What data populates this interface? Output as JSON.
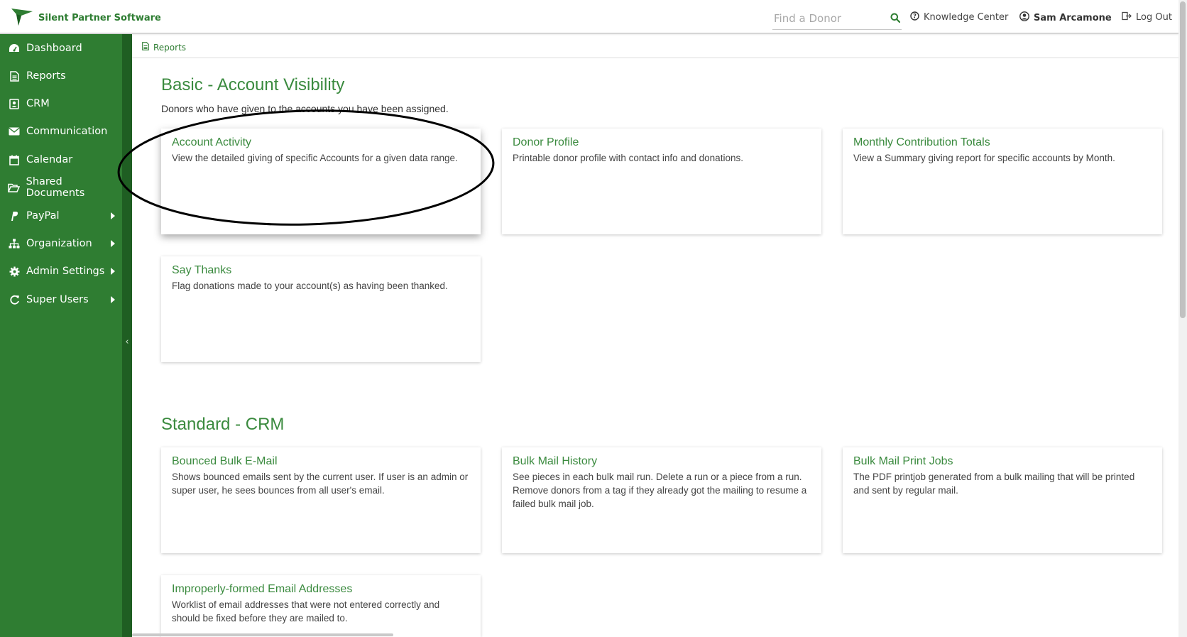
{
  "header": {
    "brand": "Silent Partner Software",
    "search_placeholder": "Find a Donor",
    "knowledge_center": "Knowledge Center",
    "user_name": "Sam Arcamone",
    "logout": "Log Out"
  },
  "sidebar": {
    "items": [
      {
        "label": "Dashboard",
        "icon": "dashboard-icon",
        "has_submenu": false
      },
      {
        "label": "Reports",
        "icon": "document-icon",
        "has_submenu": false
      },
      {
        "label": "CRM",
        "icon": "contact-card-icon",
        "has_submenu": false
      },
      {
        "label": "Communication",
        "icon": "envelope-icon",
        "has_submenu": false
      },
      {
        "label": "Calendar",
        "icon": "calendar-icon",
        "has_submenu": false
      },
      {
        "label": "Shared Documents",
        "icon": "folder-open-icon",
        "has_submenu": false
      },
      {
        "label": "PayPal",
        "icon": "paypal-icon",
        "has_submenu": true
      },
      {
        "label": "Organization",
        "icon": "sitemap-icon",
        "has_submenu": true
      },
      {
        "label": "Admin Settings",
        "icon": "gear-icon",
        "has_submenu": true
      },
      {
        "label": "Super Users",
        "icon": "refresh-icon",
        "has_submenu": true
      }
    ],
    "collapse_glyph": "‹"
  },
  "breadcrumb": {
    "label": "Reports"
  },
  "sections": [
    {
      "title": "Basic - Account Visibility",
      "subtitle": "Donors who have given to the accounts you have been assigned.",
      "cards": [
        {
          "title": "Account Activity",
          "description": "View the detailed giving of specific Accounts for a given data range."
        },
        {
          "title": "Donor Profile",
          "description": "Printable donor profile with contact info and donations."
        },
        {
          "title": "Monthly Contribution Totals",
          "description": "View a Summary giving report for specific accounts by Month."
        },
        {
          "title": "Say Thanks",
          "description": "Flag donations made to your account(s) as having been thanked."
        }
      ]
    },
    {
      "title": "Standard - CRM",
      "subtitle": "",
      "cards": [
        {
          "title": "Bounced Bulk E-Mail",
          "description": "Shows bounced emails sent by the current user. If user is an admin or super user, he sees bounces from all user's email."
        },
        {
          "title": "Bulk Mail History",
          "description": "See pieces in each bulk mail run. Delete a run or a piece from a run. Remove donors from a tag if they already got the mailing to resume a failed bulk mail job."
        },
        {
          "title": "Bulk Mail Print Jobs",
          "description": "The PDF printjob generated from a bulk mailing that will be printed and sent by regular mail."
        },
        {
          "title": "Improperly-formed Email Addresses",
          "description": "Worklist of email addresses that were not entered correctly and should be fixed before they are mailed to."
        }
      ]
    }
  ],
  "colors": {
    "brand_green": "#2f7d32",
    "title_green": "#3a8a3e"
  }
}
